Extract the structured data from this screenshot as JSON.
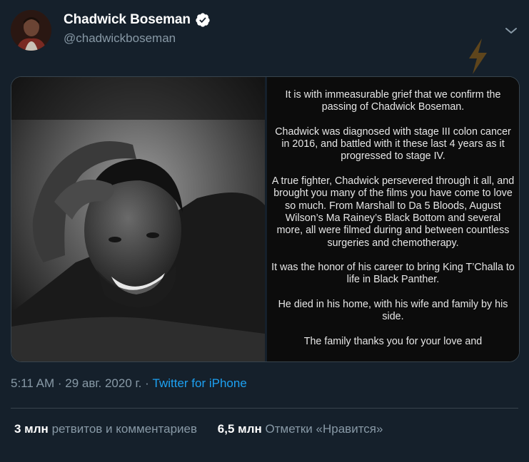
{
  "tweet": {
    "author": {
      "name": "Chadwick Boseman",
      "handle": "@chadwickboseman",
      "verified": true,
      "avatar_icon": "avatar-portrait"
    },
    "menu_icon": "chevron-down-icon",
    "overlay_icon": "lightning-bolt-icon",
    "media": {
      "photo_icon": "black-and-white-portrait-photo",
      "statement": [
        "It is with immeasurable grief that we confirm the passing of Chadwick Boseman.",
        "Chadwick was diagnosed with stage III colon cancer in 2016, and battled with it these last 4 years as it progressed to stage IV.",
        "A true fighter, Chadwick persevered through it all, and brought you many of the films you have come to love so much. From Marshall to Da 5 Bloods, August Wilson’s Ma Rainey’s Black Bottom and several more, all were filmed during and between countless surgeries and chemotherapy.",
        "It was the honor of his career to bring King T’Challa to life in Black Panther.",
        "He died in his home, with his wife and family by his side.",
        "The family thanks you for your love and"
      ]
    },
    "time": "5:11 AM",
    "date": "29 авг. 2020 г.",
    "separator": "·",
    "source": "Twitter for iPhone",
    "stats": {
      "retweets_count": "3 млн",
      "retweets_label": "ретвитов и комментариев",
      "likes_count": "6,5 млн",
      "likes_label": "Отметки «Нравится»"
    },
    "colors": {
      "background": "#15202b",
      "secondary_text": "#8899a6",
      "link": "#1da1f2",
      "border": "#38444d"
    }
  }
}
